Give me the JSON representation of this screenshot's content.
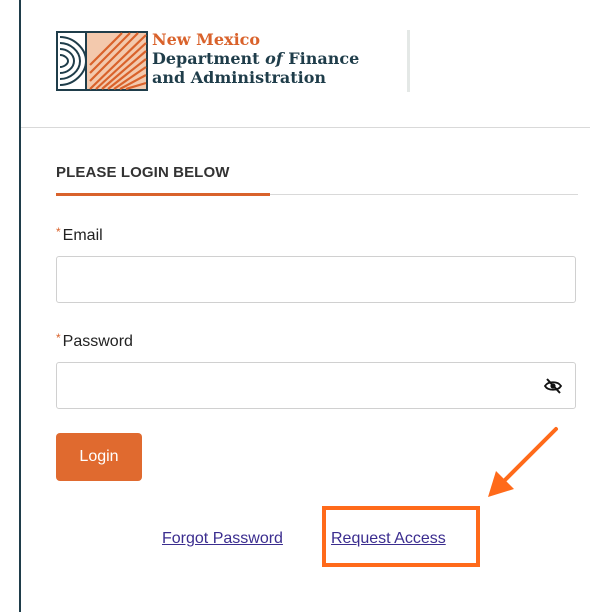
{
  "header": {
    "logo_line1": "New Mexico",
    "logo_line2_pre": "Department ",
    "logo_line2_of": "of",
    "logo_line2_post": " Finance",
    "logo_line3": "and Administration",
    "logo_icon": "dfa-logo-icon"
  },
  "login": {
    "section_title": "PLEASE LOGIN BELOW",
    "email_label": "Email",
    "email_value": "",
    "password_label": "Password",
    "password_value": "",
    "required_marker": "*",
    "login_label": "Login",
    "eye_icon": "eye-slash-icon"
  },
  "links": {
    "forgot_password": "Forgot Password",
    "request_access": "Request Access"
  },
  "annotation": {
    "highlight_color": "#ff6a1a",
    "arrow_icon": "arrow-icon"
  },
  "colors": {
    "accent": "#d9622b",
    "button": "#e06a2f",
    "link": "#3b2d8f",
    "dark": "#1f3d4a"
  }
}
